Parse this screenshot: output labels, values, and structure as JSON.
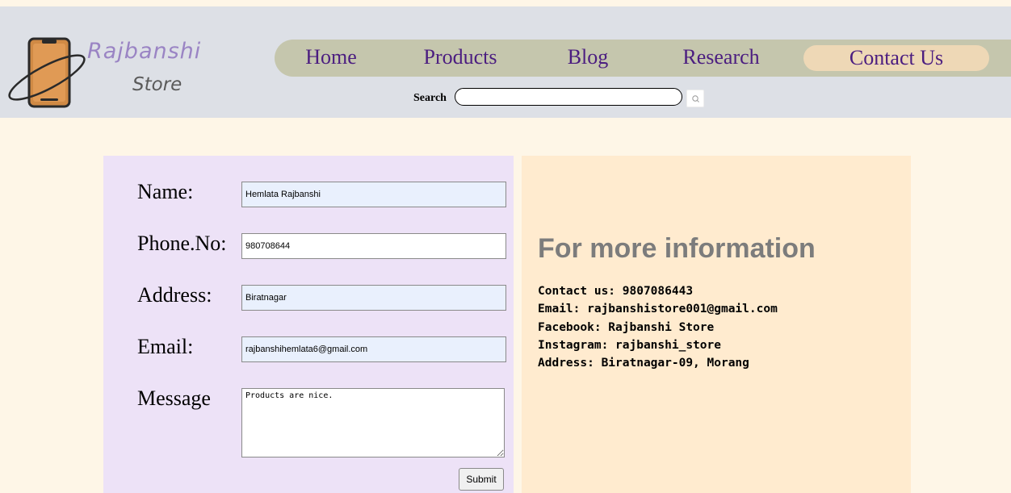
{
  "brand": {
    "line1": "Rajbanshi",
    "line2": "Store",
    "colors": {
      "primary": "#9a84c4",
      "secondary": "#5a5a5a"
    }
  },
  "nav": {
    "items": [
      {
        "label": "Home"
      },
      {
        "label": "Products"
      },
      {
        "label": "Blog"
      },
      {
        "label": "Research"
      },
      {
        "label": "Contact Us",
        "active": true
      }
    ],
    "colors": {
      "bar": "#c5c6ad",
      "active": "#eed8b6",
      "text": "#4b1d80"
    }
  },
  "search": {
    "label": "Search",
    "value": "",
    "icon": "search-icon"
  },
  "form": {
    "name_label": "Name:",
    "name_value": "Hemlata Rajbanshi",
    "phone_label": "Phone.No:",
    "phone_value": "980708644",
    "address_label": "Address:",
    "address_value": "Biratnagar",
    "email_label": "Email:",
    "email_value": "rajbanshihemlata6@gmail.com",
    "message_label": "Message",
    "message_value": "Products are nice.",
    "submit_label": "Submit"
  },
  "info": {
    "title": "For more information",
    "lines": [
      "Contact us: 9807086443",
      "Email: rajbanshistore001@gmail.com",
      "Facebook: Rajbanshi Store",
      "Instagram: rajbanshi_store",
      "Address: Biratnagar-09, Morang"
    ]
  }
}
